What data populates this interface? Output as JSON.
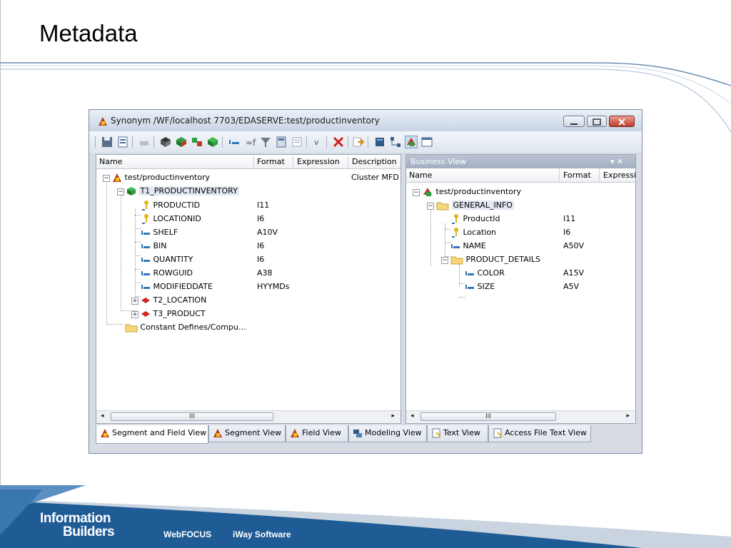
{
  "slide": {
    "title": "Metadata"
  },
  "window": {
    "title": "Synonym /WF/localhost 7703/EDASERVE:test/productinventory"
  },
  "left_pane": {
    "columns": [
      "Name",
      "Format",
      "Expression",
      "Description"
    ],
    "rows": [
      {
        "name": "test/productinventory",
        "format": "",
        "description": "Cluster MFD f",
        "icon": "synonym-icon"
      },
      {
        "name": "T1_PRODUCTINVENTORY",
        "format": "",
        "icon": "segment-icon"
      },
      {
        "name": "PRODUCTID",
        "format": "I11",
        "icon": "key-field-icon"
      },
      {
        "name": "LOCATIONID",
        "format": "I6",
        "icon": "key-field-icon"
      },
      {
        "name": "SHELF",
        "format": "A10V",
        "icon": "field-icon"
      },
      {
        "name": "BIN",
        "format": "I6",
        "icon": "field-icon"
      },
      {
        "name": "QUANTITY",
        "format": "I6",
        "icon": "field-icon"
      },
      {
        "name": "ROWGUID",
        "format": "A38",
        "icon": "field-icon"
      },
      {
        "name": "MODIFIEDDATE",
        "format": "HYYMDs",
        "icon": "field-icon"
      },
      {
        "name": "T2_LOCATION",
        "format": "",
        "icon": "cross-ref-segment-icon"
      },
      {
        "name": "T3_PRODUCT",
        "format": "",
        "icon": "cross-ref-segment-icon"
      },
      {
        "name": "Constant Defines/Compu…",
        "format": "",
        "icon": "folder-icon"
      }
    ],
    "scroll_thumb": "III"
  },
  "right_pane": {
    "panel_title": "Business View",
    "panel_controls": "▾ ✕",
    "columns": [
      "Name",
      "Format",
      "Expressi"
    ],
    "rows": [
      {
        "name": "test/productinventory",
        "format": "",
        "icon": "business-view-icon"
      },
      {
        "name": "GENERAL_INFO",
        "format": "",
        "icon": "folder-icon"
      },
      {
        "name": "ProductId",
        "format": "I11",
        "icon": "key-field-icon"
      },
      {
        "name": "Location",
        "format": "I6",
        "icon": "key-field-icon"
      },
      {
        "name": "NAME",
        "format": "A50V",
        "icon": "field-icon"
      },
      {
        "name": "PRODUCT_DETAILS",
        "format": "",
        "icon": "folder-icon"
      },
      {
        "name": "COLOR",
        "format": "A15V",
        "icon": "field-icon"
      },
      {
        "name": "SIZE",
        "format": "A5V",
        "icon": "field-icon"
      }
    ],
    "scroll_thumb": "III"
  },
  "tabs": [
    {
      "label": "Segment and Field View",
      "active": true
    },
    {
      "label": "Segment View"
    },
    {
      "label": "Field View"
    },
    {
      "label": "Modeling View"
    },
    {
      "label": "Text View"
    },
    {
      "label": "Access File Text View"
    }
  ],
  "footer": {
    "logo_line1": "Information",
    "logo_line2": "Builders",
    "brand1": "WebFOCUS",
    "brand2": "iWay Software"
  },
  "colors": {
    "accent": "#2f6ea8",
    "footer_dark": "#1f5c96",
    "footer_light": "#5b8fc2",
    "selected_row": "#e3e9f2"
  }
}
